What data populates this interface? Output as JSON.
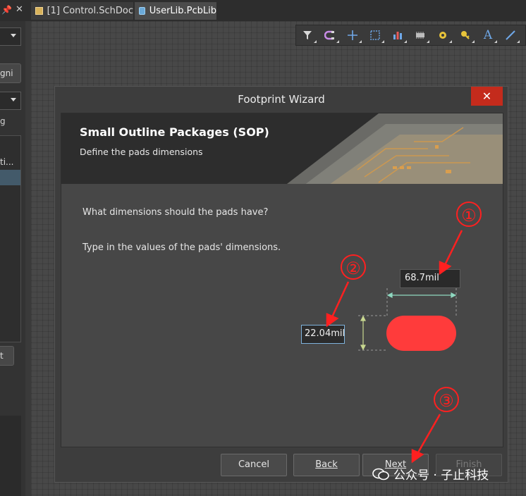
{
  "tabs": [
    {
      "label": "[1] Control.SchDoc",
      "icon": "schematic-doc-icon"
    },
    {
      "label": "UserLib.PcbLib",
      "icon": "pcblib-doc-icon",
      "active": true
    }
  ],
  "left_panel": {
    "button_top": "gni",
    "text_label": "g",
    "list_items": [
      "ti...",
      ""
    ],
    "button_bottom": "t"
  },
  "toolbar": {
    "icons": [
      "filter-icon",
      "magnet-route-icon",
      "crosshair-icon",
      "select-rect-icon",
      "chart-icon",
      "component-icon",
      "pad-icon",
      "key-icon",
      "text-icon",
      "line-icon"
    ]
  },
  "dialog": {
    "title": "Footprint Wizard",
    "close_label": "✕",
    "banner_title": "Small Outline Packages (SOP)",
    "banner_subtitle": "Define the pads dimensions",
    "question": "What dimensions should the pads have?",
    "instruction": "Type in the values of the pads' dimensions.",
    "pad_length": "68.7mil",
    "pad_width": "22.04mil",
    "pad_color": "#ff3b3b",
    "buttons": {
      "cancel": "Cancel",
      "back": "Back",
      "next": "Next",
      "finish": "Finish"
    }
  },
  "annotations": {
    "markers": [
      "①",
      "②",
      "③"
    ],
    "color": "#ff2020"
  },
  "watermark": "公众号 · 子止科技"
}
